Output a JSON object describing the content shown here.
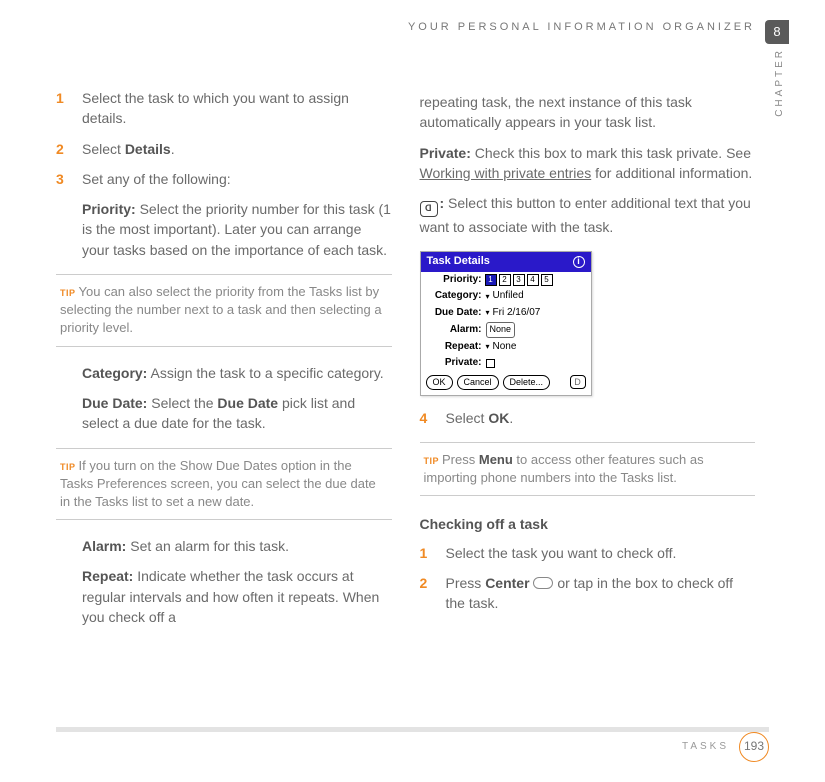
{
  "header": {
    "title": "YOUR PERSONAL INFORMATION ORGANIZER",
    "chapter_number": "8",
    "chapter_label": "CHAPTER"
  },
  "footer": {
    "section": "TASKS",
    "page": "193"
  },
  "left": {
    "steps": [
      {
        "n": "1",
        "text": "Select the task to which you want to assign details."
      },
      {
        "n": "2",
        "prefix": "Select ",
        "bold": "Details",
        "suffix": "."
      },
      {
        "n": "3",
        "text": "Set any of the following:"
      }
    ],
    "priority": {
      "label": "Priority:",
      "text": " Select the priority number for this task (1 is the most important). Later you can arrange your tasks based on the importance of each task."
    },
    "tip1": {
      "label": "TIP",
      "text": "You can also select the priority from the Tasks list by selecting the number next to a task and then selecting a priority level."
    },
    "category": {
      "label": "Category:",
      "text": " Assign the task to a specific category."
    },
    "duedate": {
      "label": "Due Date:",
      "prefix": " Select the ",
      "bold": "Due Date",
      "suffix": " pick list and select a due date for the task."
    },
    "tip2": {
      "label": "TIP",
      "text": "If you turn on the Show Due Dates option in the Tasks Preferences screen, you can select the due date in the Tasks list to set a new date."
    },
    "alarm": {
      "label": "Alarm:",
      "text": " Set an alarm for this task."
    },
    "repeat": {
      "label": "Repeat:",
      "text": " Indicate whether the task occurs at regular intervals and how often it repeats. When you check off a"
    }
  },
  "right": {
    "repeat_cont": "repeating task, the next instance of this task automatically appears in your task list.",
    "private": {
      "label": "Private:",
      "prefix": " Check this box to mark this task private. See ",
      "link": "Working with private entries",
      "suffix": " for additional information."
    },
    "noteicon": {
      "suffix": " Select this button to enter additional text that you want to associate with the task."
    },
    "dialog": {
      "title": "Task Details",
      "rows": {
        "priority_label": "Priority:",
        "priority_cells": [
          "1",
          "2",
          "3",
          "4",
          "5"
        ],
        "category_label": "Category:",
        "category_val": "Unfiled",
        "duedate_label": "Due Date:",
        "duedate_val": "Fri 2/16/07",
        "alarm_label": "Alarm:",
        "alarm_val": "None",
        "repeat_label": "Repeat:",
        "repeat_val": "None",
        "private_label": "Private:"
      },
      "buttons": {
        "ok": "OK",
        "cancel": "Cancel",
        "delete": "Delete..."
      }
    },
    "step4": {
      "n": "4",
      "prefix": "Select ",
      "bold": "OK",
      "suffix": "."
    },
    "tip3": {
      "label": "TIP",
      "prefix": "Press ",
      "bold": "Menu",
      "suffix": " to access other features such as importing phone numbers into the Tasks list."
    },
    "subhead": "Checking off a task",
    "check_steps": [
      {
        "n": "1",
        "text": "Select the task you want to check off."
      },
      {
        "n": "2",
        "prefix": "Press ",
        "bold": "Center",
        "suffix": " or tap in the box to check off the task."
      }
    ]
  }
}
